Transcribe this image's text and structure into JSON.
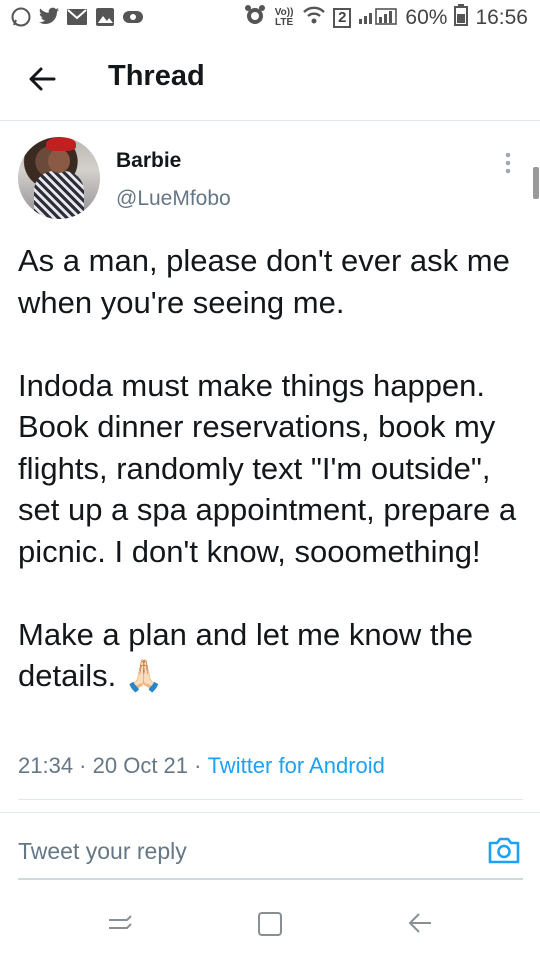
{
  "status_bar": {
    "volte": "Vo)) LTE",
    "sim": "2",
    "battery_percent": "60%",
    "time": "16:56"
  },
  "header": {
    "title": "Thread"
  },
  "tweet": {
    "name": "Barbie",
    "handle": "@LueMfobo",
    "text": "As a man, please don't ever ask me when you're seeing me.\n\nIndoda must make things happen. Book dinner reservations, book my flights, randomly text \"I'm outside\", set up a spa appointment, prepare a picnic. I don't know, sooomething!\n\nMake a plan and let me know the details. 🙏🏻",
    "time": "21:34",
    "date": "20 Oct 21",
    "source": "Twitter for Android"
  },
  "reply": {
    "placeholder": "Tweet your reply"
  },
  "icons": {
    "back": "arrow-left",
    "more": "vertical-ellipsis",
    "camera": "camera",
    "nav_recent": "recent-apps",
    "nav_home": "home",
    "nav_back": "back"
  },
  "colors": {
    "link": "#1da1f2",
    "secondary_text": "#657786",
    "primary_text": "#14171a"
  }
}
